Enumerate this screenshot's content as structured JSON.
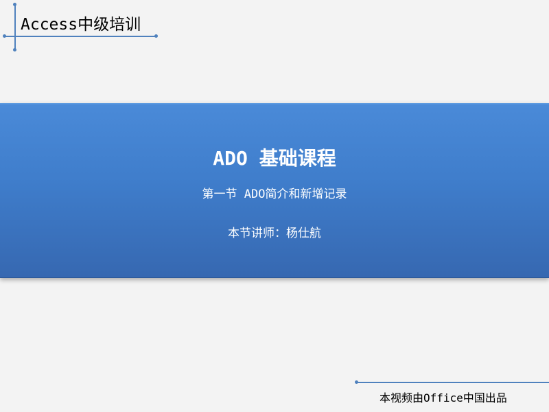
{
  "header": {
    "title": "Access中级培训"
  },
  "band": {
    "title": "ADO 基础课程",
    "subtitle": "第一节 ADO简介和新增记录",
    "lecturer": "本节讲师：杨仕航"
  },
  "footer": {
    "credit": "本视频由Office中国出品"
  },
  "colors": {
    "accent": "#4f81bd",
    "band_top": "#4a8ad8",
    "band_bottom": "#3668b1",
    "background": "#f3f3f3"
  }
}
